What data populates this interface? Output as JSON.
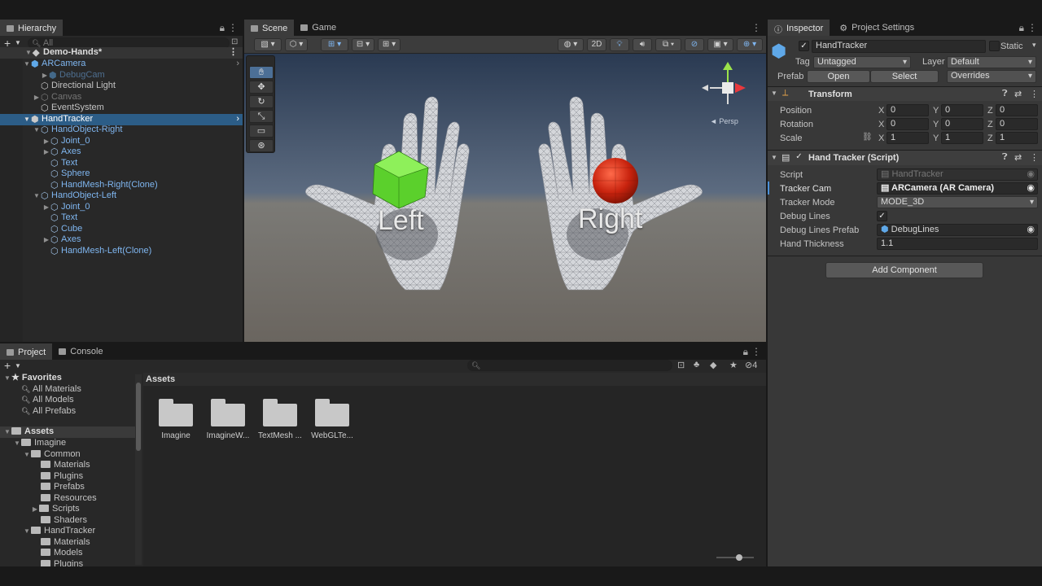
{
  "hierarchy": {
    "tab": "Hierarchy",
    "search_placeholder": "All",
    "scene_name": "Demo-Hands*",
    "items": [
      {
        "label": "ARCamera"
      },
      {
        "label": "DebugCam"
      },
      {
        "label": "Directional Light"
      },
      {
        "label": "Canvas"
      },
      {
        "label": "EventSystem"
      },
      {
        "label": "HandTracker"
      },
      {
        "label": "HandObject-Right"
      },
      {
        "label": "Joint_0"
      },
      {
        "label": "Axes"
      },
      {
        "label": "Text"
      },
      {
        "label": "Sphere"
      },
      {
        "label": "HandMesh-Right(Clone)"
      },
      {
        "label": "HandObject-Left"
      },
      {
        "label": "Joint_0"
      },
      {
        "label": "Text"
      },
      {
        "label": "Cube"
      },
      {
        "label": "Axes"
      },
      {
        "label": "HandMesh-Left(Clone)"
      }
    ]
  },
  "scene": {
    "tabs": {
      "scene": "Scene",
      "game": "Game"
    },
    "mode_2d": "2D",
    "gizmo_label": "◄ Persp",
    "left_hand_label": "Left",
    "right_hand_label": "Right"
  },
  "inspector": {
    "tabs": {
      "inspector": "Inspector",
      "project_settings": "Project Settings"
    },
    "object_name": "HandTracker",
    "static_label": "Static",
    "tag_label": "Tag",
    "tag_value": "Untagged",
    "layer_label": "Layer",
    "layer_value": "Default",
    "prefab_label": "Prefab",
    "open_btn": "Open",
    "select_btn": "Select",
    "overrides": "Overrides",
    "transform": {
      "title": "Transform",
      "position_label": "Position",
      "rotation_label": "Rotation",
      "scale_label": "Scale",
      "x": "X",
      "y": "Y",
      "z": "Z",
      "position": [
        "0",
        "0",
        "0"
      ],
      "rotation": [
        "0",
        "0",
        "0"
      ],
      "scale": [
        "1",
        "1",
        "1"
      ]
    },
    "script": {
      "title": "Hand Tracker (Script)",
      "fields": {
        "script_label": "Script",
        "script_value": "HandTracker",
        "tracker_cam_label": "Tracker Cam",
        "tracker_cam_value": "ARCamera (AR Camera)",
        "tracker_mode_label": "Tracker Mode",
        "tracker_mode_value": "MODE_3D",
        "debug_lines_label": "Debug Lines",
        "debug_lines_value": "✓",
        "debug_lines_prefab_label": "Debug Lines Prefab",
        "debug_lines_prefab_value": "DebugLines",
        "hand_thickness_label": "Hand Thickness",
        "hand_thickness_value": "1.1"
      }
    },
    "add_component": "Add Component"
  },
  "project": {
    "tabs": {
      "project": "Project",
      "console": "Console"
    },
    "hidden_count": "4",
    "breadcrumb": "Assets",
    "favorites": {
      "label": "Favorites",
      "items": [
        "All Materials",
        "All Models",
        "All Prefabs"
      ]
    },
    "tree": {
      "assets": "Assets",
      "imagine": "Imagine",
      "common": "Common",
      "common_children": [
        "Materials",
        "Plugins",
        "Prefabs",
        "Resources",
        "Scripts",
        "Shaders"
      ],
      "handtracker": "HandTracker",
      "ht_children": [
        "Materials",
        "Models",
        "Plugins"
      ]
    },
    "assets": [
      "Imagine",
      "ImagineW...",
      "TextMesh ...",
      "WebGLTe..."
    ]
  }
}
